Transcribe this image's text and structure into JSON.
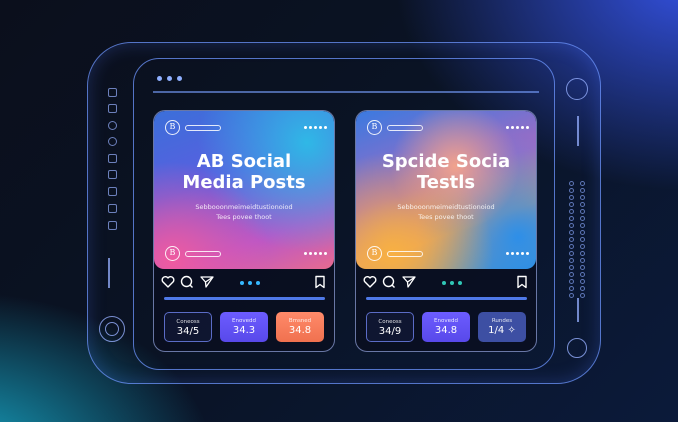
{
  "colors": {
    "accent_blue": "#3b5bff",
    "accent_cyan": "#18b6d6",
    "frame_line": "#6e96ff",
    "stat_violet": "#6c5cff",
    "stat_coral": "#f0714f",
    "stat_slate": "#3d4fa3"
  },
  "frame": {
    "top_dots": 3,
    "left_icons": [
      "home-icon",
      "grid-icon",
      "add-icon",
      "comment-icon",
      "share-icon",
      "calendar-icon",
      "list-icon",
      "info-icon",
      "bookmark-icon"
    ],
    "right_icons": [
      "filter-icon",
      "add-circle-icon"
    ]
  },
  "cards": [
    {
      "avatar": "B",
      "title_line1": "AB Social",
      "title_line2": "Media Posts",
      "caption_line1": "Sebbooonmeimeidtustionoiod",
      "caption_line2": "Tees povee thoot",
      "stats": [
        {
          "label": "Coneoss",
          "value": "34/5"
        },
        {
          "label": "Enovedd",
          "value": "34.3"
        },
        {
          "label": "Bmsned",
          "value": "34.8"
        }
      ]
    },
    {
      "avatar": "B",
      "title_line1": "Spcide Socia",
      "title_line2": "Testls",
      "caption_line1": "Sebbooonmeimeidtustionoiod",
      "caption_line2": "Tees povee thoot",
      "stats": [
        {
          "label": "Coneoss",
          "value": "34/9"
        },
        {
          "label": "Enovedd",
          "value": "34.8"
        },
        {
          "label": "Rundes",
          "value": "1/4 ✧"
        }
      ]
    }
  ]
}
